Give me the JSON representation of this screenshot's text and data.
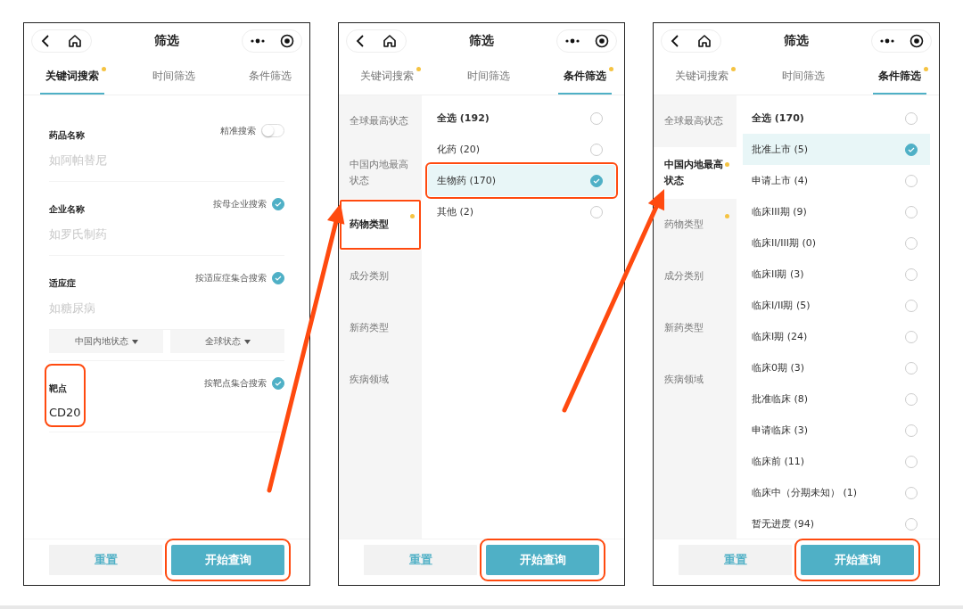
{
  "screens": [
    {
      "kind": "keyword",
      "title": "筛选",
      "tabs": [
        {
          "label": "关键词搜索",
          "selected": true,
          "dot": true
        },
        {
          "label": "时间筛选",
          "selected": false,
          "dot": false
        },
        {
          "label": "条件筛选",
          "selected": false,
          "dot": false
        }
      ],
      "fields": [
        {
          "label": "药品名称",
          "placeholder": "如阿帕替尼",
          "highlighted": false,
          "option": {
            "kind": "switch",
            "label": "精准搜索",
            "on": false
          }
        },
        {
          "label": "企业名称",
          "placeholder": "如罗氏制药",
          "highlighted": false,
          "option": {
            "kind": "check",
            "label": "按母企业搜索",
            "checked": true
          }
        },
        {
          "label": "适应症",
          "placeholder": "如糖尿病",
          "highlighted": false,
          "option": {
            "kind": "check",
            "label": "按适应症集合搜索",
            "checked": true
          },
          "dropdowns": [
            "中国内地状态",
            "全球状态"
          ]
        },
        {
          "label": "靶点",
          "value": "CD20",
          "highlighted": true,
          "option": {
            "kind": "check",
            "label": "按靶点集合搜索",
            "checked": true
          }
        }
      ],
      "buttons": [
        {
          "kind": "secondary",
          "label": "重置"
        },
        {
          "kind": "primary",
          "label": "开始查询",
          "highlighted": true
        }
      ]
    },
    {
      "kind": "conditions",
      "title": "筛选",
      "tabs": [
        {
          "label": "关键词搜索",
          "selected": false,
          "dot": true
        },
        {
          "label": "时间筛选",
          "selected": false,
          "dot": false
        },
        {
          "label": "条件筛选",
          "selected": true,
          "dot": true
        }
      ],
      "sidebar": [
        {
          "label": "全球最高状态",
          "selected": false,
          "dot": false,
          "highlighted": false
        },
        {
          "label": "中国内地最高状态",
          "selected": false,
          "dot": false,
          "highlighted": false
        },
        {
          "label": "药物类型",
          "selected": true,
          "dot": true,
          "highlighted": true
        },
        {
          "label": "成分类别",
          "selected": false,
          "dot": false,
          "highlighted": false
        },
        {
          "label": "新药类型",
          "selected": false,
          "dot": false,
          "highlighted": false
        },
        {
          "label": "疾病领域",
          "selected": false,
          "dot": false,
          "highlighted": false
        }
      ],
      "options": [
        {
          "kind": "all",
          "label": "全选 (192)",
          "selected": false,
          "highlighted": false
        },
        {
          "kind": "item",
          "label": "化药 (20)",
          "selected": false,
          "highlighted": false
        },
        {
          "kind": "item",
          "label": "生物药 (170)",
          "selected": true,
          "highlighted": true
        },
        {
          "kind": "item",
          "label": "其他 (2)",
          "selected": false,
          "highlighted": false
        }
      ],
      "buttons": [
        {
          "kind": "secondary",
          "label": "重置"
        },
        {
          "kind": "primary",
          "label": "开始查询",
          "highlighted": true
        }
      ]
    },
    {
      "kind": "conditions",
      "title": "筛选",
      "tabs": [
        {
          "label": "关键词搜索",
          "selected": false,
          "dot": true
        },
        {
          "label": "时间筛选",
          "selected": false,
          "dot": false
        },
        {
          "label": "条件筛选",
          "selected": true,
          "dot": true
        }
      ],
      "sidebar": [
        {
          "label": "全球最高状态",
          "selected": false,
          "dot": false,
          "highlighted": false
        },
        {
          "label": "中国内地最高状态",
          "selected": true,
          "dot": true,
          "highlighted": false
        },
        {
          "label": "药物类型",
          "selected": false,
          "dot": true,
          "highlighted": false
        },
        {
          "label": "成分类别",
          "selected": false,
          "dot": false,
          "highlighted": false
        },
        {
          "label": "新药类型",
          "selected": false,
          "dot": false,
          "highlighted": false
        },
        {
          "label": "疾病领域",
          "selected": false,
          "dot": false,
          "highlighted": false
        }
      ],
      "options": [
        {
          "kind": "all",
          "label": "全选 (170)",
          "selected": false,
          "highlighted": false
        },
        {
          "kind": "item",
          "label": "批准上市 (5)",
          "selected": true,
          "highlighted": false
        },
        {
          "kind": "item",
          "label": "申请上市 (4)",
          "selected": false,
          "highlighted": false
        },
        {
          "kind": "item",
          "label": "临床III期 (9)",
          "selected": false,
          "highlighted": false
        },
        {
          "kind": "item",
          "label": "临床II/III期 (0)",
          "selected": false,
          "highlighted": false
        },
        {
          "kind": "item",
          "label": "临床II期 (3)",
          "selected": false,
          "highlighted": false
        },
        {
          "kind": "item",
          "label": "临床I/II期 (5)",
          "selected": false,
          "highlighted": false
        },
        {
          "kind": "item",
          "label": "临床I期 (24)",
          "selected": false,
          "highlighted": false
        },
        {
          "kind": "item",
          "label": "临床0期 (3)",
          "selected": false,
          "highlighted": false
        },
        {
          "kind": "item",
          "label": "批准临床 (8)",
          "selected": false,
          "highlighted": false
        },
        {
          "kind": "item",
          "label": "申请临床 (3)",
          "selected": false,
          "highlighted": false
        },
        {
          "kind": "item",
          "label": "临床前 (11)",
          "selected": false,
          "highlighted": false
        },
        {
          "kind": "item",
          "label": "临床中（分期未知） (1)",
          "selected": false,
          "highlighted": false
        },
        {
          "kind": "item",
          "label": "暂无进度 (94)",
          "selected": false,
          "highlighted": false
        }
      ],
      "buttons": [
        {
          "kind": "secondary",
          "label": "重置"
        },
        {
          "kind": "primary",
          "label": "开始查询",
          "highlighted": true
        }
      ]
    }
  ]
}
